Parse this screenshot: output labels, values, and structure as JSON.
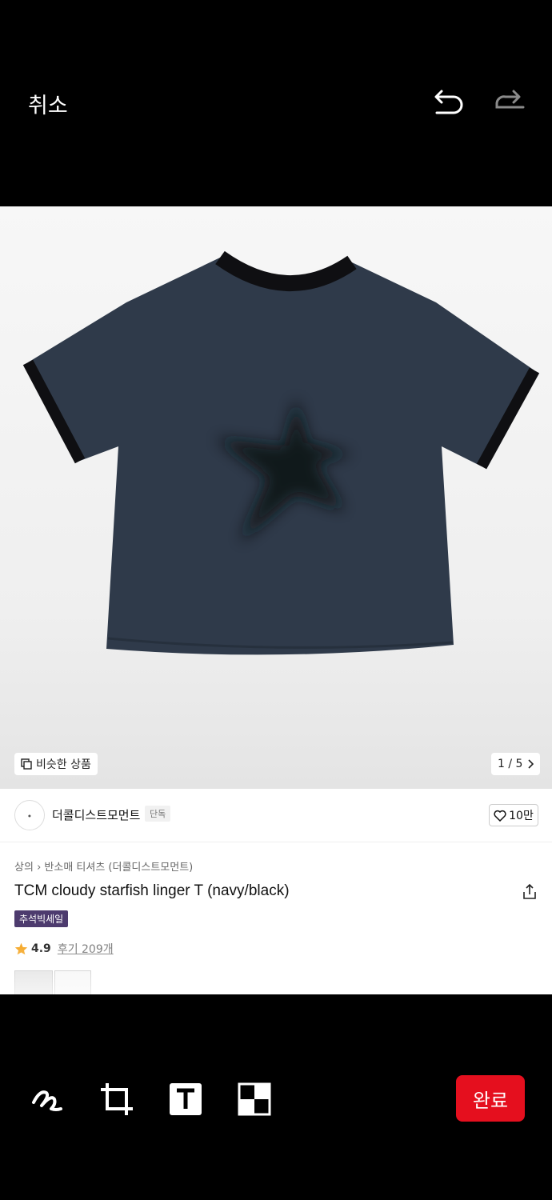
{
  "header": {
    "cancel_label": "취소"
  },
  "product": {
    "similar_label": "비슷한 상품",
    "pager": "1 / 5",
    "brand_name": "더콜디스트모먼트",
    "brand_tag": "단독",
    "likes": "10만",
    "breadcrumb_category": "상의",
    "breadcrumb_sub": "반소매 티셔츠 (더콜디스트모먼트)",
    "title": "TCM cloudy starfish linger T (navy/black)",
    "sale_badge": "추석빅세일",
    "rating": "4.9",
    "reviews": "후기 209개"
  },
  "toolbar": {
    "done_label": "완료"
  },
  "icons": [
    "undo-icon",
    "redo-icon",
    "pen-icon",
    "crop-icon",
    "text-icon",
    "mosaic-icon",
    "heart-icon",
    "share-icon",
    "star-icon",
    "chevron-right-icon"
  ],
  "colors": {
    "accent": "#e50f1e",
    "sale_badge": "#4d3b6e",
    "star": "#f5a623"
  }
}
